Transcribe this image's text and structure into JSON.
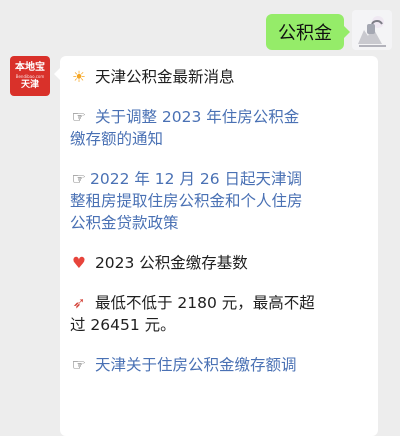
{
  "right_message": {
    "text": "公积金"
  },
  "bot": {
    "brand": "本地宝",
    "brand_sub": "Bendibao.com",
    "city": "天津"
  },
  "left_message": {
    "title": "天津公积金最新消息",
    "link1_line1": "关于调整 2023 年住房公积金",
    "link1_line2": "缴存额的通知",
    "link2_line1": "2022 年 12 月 26 日起天津调",
    "link2_line2": "整租房提取住房公积金和个人住房",
    "link2_line3": "公积金贷款政策",
    "base_title": "2023 公积金缴存基数",
    "base_line1": "最低不低于 2180 元，最高不超",
    "base_line2": "过 26451 元。",
    "link3_line1": "天津关于住房公积金缴存额调"
  },
  "icons": {
    "sun": "sun-icon",
    "hand": "hand-point-icon",
    "heart": "heart-icon",
    "pin": "pin-icon"
  },
  "colors": {
    "right_bubble": "#95ec69",
    "link": "#4a71b4",
    "brand": "#d9312a"
  }
}
